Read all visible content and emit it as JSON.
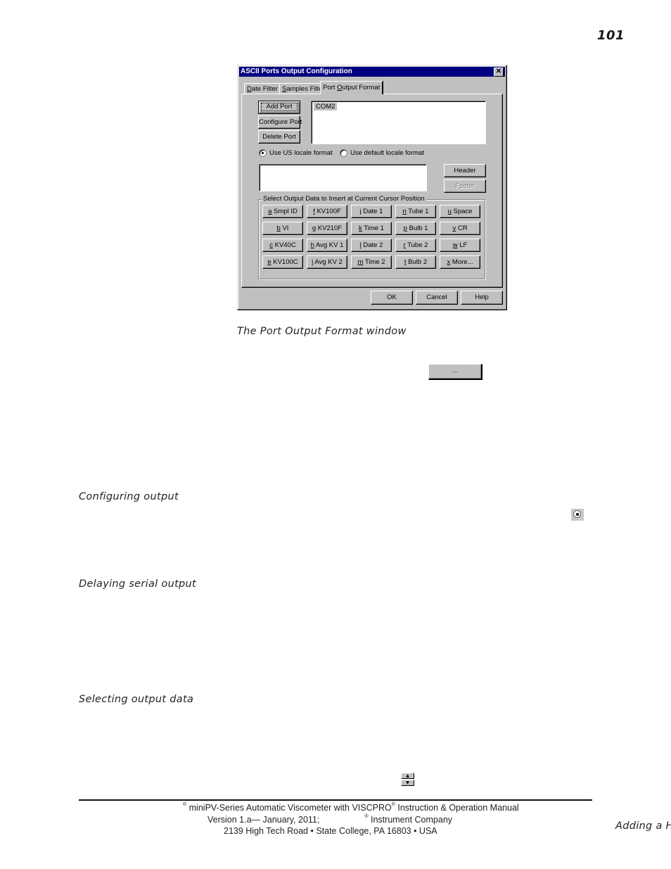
{
  "page": {
    "number": "101",
    "caption": "The Port Output Format window",
    "ellipsis_button_label": "...",
    "side_headings": {
      "configuring_output": "Configuring output",
      "delaying_serial_output": "Delaying serial output",
      "selecting_output_data": "Selecting output data"
    },
    "inline_icons": [
      "radio-button-icon",
      "spinner-arrows-icon"
    ],
    "running_footer": "Adding a H"
  },
  "dialog": {
    "title": "ASCII Ports Output Configuration",
    "close_label": "✕",
    "tabs": [
      {
        "label": "Date Filter",
        "mnemonic": "D",
        "rest": "ate Filter",
        "active": false
      },
      {
        "label": "Samples Filter",
        "mnemonic": "S",
        "rest": "amples Filter",
        "active": false
      },
      {
        "label": "Port Output Format",
        "prefix": "Port ",
        "mnemonic": "O",
        "rest": "utput Format",
        "active": true
      }
    ],
    "port_buttons": {
      "add": "Add Port",
      "configure": "Configure Port",
      "delete": "Delete Port"
    },
    "ports_list": [
      "COM2"
    ],
    "locale": {
      "us_label": "Use US locale format",
      "default_label": "Use default locale format",
      "selected": "us"
    },
    "format_text": "",
    "header_button": "Header",
    "footer_button": "Footer",
    "footer_button_enabled": false,
    "group_label": "Select Output Data to Insert at Current Cursor Position",
    "data_buttons": [
      [
        {
          "key": "a",
          "label": " Smpl ID"
        },
        {
          "key": "f",
          "label": " KV100F"
        },
        {
          "key": "j",
          "label": " Date 1"
        },
        {
          "key": "n",
          "label": " Tube 1"
        },
        {
          "key": "u",
          "label": " Space"
        }
      ],
      [
        {
          "key": "b",
          "label": " VI"
        },
        {
          "key": "g",
          "label": " KV210F"
        },
        {
          "key": "k",
          "label": " Time 1"
        },
        {
          "key": "p",
          "label": " Bulb 1"
        },
        {
          "key": "v",
          "label": " CR"
        }
      ],
      [
        {
          "key": "c",
          "label": " KV40C"
        },
        {
          "key": "h",
          "label": " Avg KV 1"
        },
        {
          "key": "l",
          "label": " Date 2"
        },
        {
          "key": "r",
          "label": " Tube 2"
        },
        {
          "key": "w",
          "label": " LF"
        }
      ],
      [
        {
          "key": "e",
          "label": " KV100C"
        },
        {
          "key": "i",
          "label": " Avg KV 2"
        },
        {
          "key": "m",
          "label": " Time 2"
        },
        {
          "key": "t",
          "label": " Bulb 2"
        },
        {
          "key": "x",
          "label": " More..."
        }
      ]
    ],
    "ok": "OK",
    "cancel": "Cancel",
    "help": "Help"
  },
  "footer": {
    "line1_reg": "®",
    "line1_a": " miniPV-Series Automatic Viscometer with VISCPRO",
    "line1_reg2": "®",
    "line1_b": " Instruction & Operation Manual",
    "line2_a": "Version 1.a— January, 2011;",
    "line2_reg": "®",
    "line2_b": " Instrument Company",
    "line3": "2139 High Tech Road • State College, PA  16803 • USA"
  }
}
